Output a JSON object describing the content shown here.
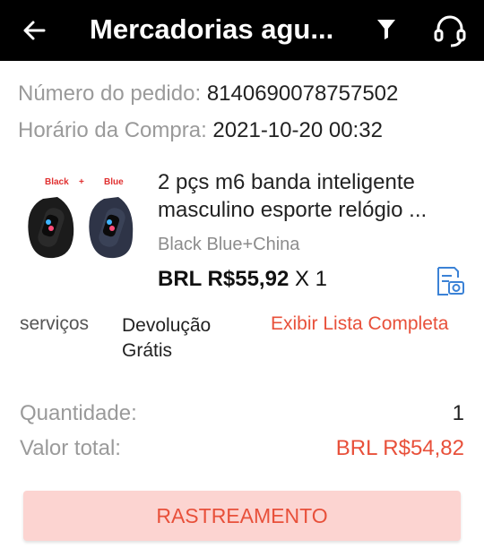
{
  "header": {
    "title": "Mercadorias agu...",
    "icons": [
      "back-arrow-icon",
      "filter-icon",
      "headset-icon"
    ]
  },
  "order": {
    "number_label": "Número do pedido:",
    "number_value": "8140690078757502",
    "time_label": "Horário da Compra:",
    "time_value": "2021-10-20 00:32"
  },
  "product": {
    "image_labels": {
      "left": "Black",
      "plus": "+",
      "right": "Blue"
    },
    "title_line1": "2 pçs m6 banda inteligente",
    "title_line2": "masculino esporte relógio ...",
    "variant": "Black Blue+China",
    "price": "BRL R$55,92",
    "qty": "X 1"
  },
  "services": {
    "label": "serviços",
    "value_line1": "Devolução",
    "value_line2": "Grátis",
    "link": "Exibir Lista Completa"
  },
  "summary": {
    "qty_label": "Quantidade:",
    "qty_value": "1",
    "total_label": "Valor total:",
    "total_value": "BRL R$54,82"
  },
  "actions": {
    "tracking": "RASTREAMENTO"
  },
  "colors": {
    "accent": "#e8503a",
    "topbar": "#000000",
    "button_bg": "#fcd4d1",
    "receipt_icon": "#3b82d6"
  }
}
